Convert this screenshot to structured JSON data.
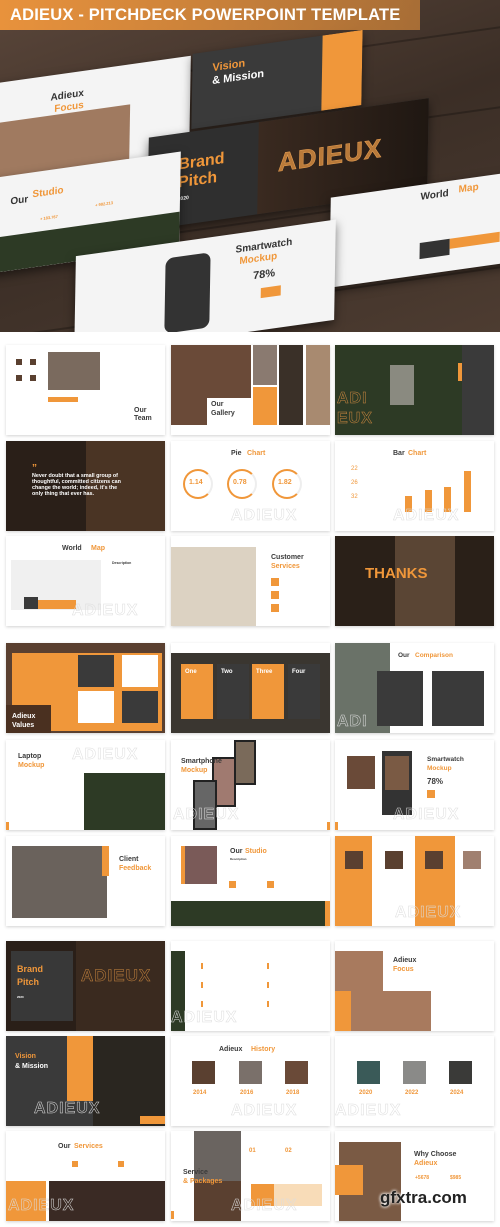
{
  "title": "ADIEUX - PITCHDECK POWERPOINT TEMPLATE",
  "colors": {
    "accent": "#f0973a",
    "dark": "#3a3a3a",
    "light": "#ffffff",
    "wood": "#4a3a30"
  },
  "hero": {
    "slides": [
      {
        "t1": "Adieux",
        "t2": "Focus"
      },
      {
        "t1": "Vision",
        "t2": "& Mission"
      },
      {
        "t1": "Brand",
        "t2": "Pitch",
        "sub": "2020"
      },
      {
        "t1": "Our",
        "t2": "Studio",
        "n1": "+ 183.767",
        "n2": "+ 982.213"
      },
      {
        "t1": "World",
        "t2": "Map"
      },
      {
        "t1": "Smartwatch",
        "t2": "Mockup",
        "pct": "78%"
      }
    ],
    "watermark": "ADIEUX"
  },
  "slides": [
    {
      "texts": [
        "Our",
        "Team"
      ]
    },
    {
      "texts": [
        "Our",
        "Gallery"
      ]
    },
    {
      "texts": [
        "ADI",
        "EUX"
      ]
    },
    {
      "texts": [
        "”",
        "Never doubt that a small group of thoughtful, committed citizens can change the world; indeed, it's the only thing that ever has."
      ]
    },
    {
      "texts": [
        "Pie",
        "Chart",
        "1.14",
        "0.78",
        "1.82",
        "ADIEUX"
      ]
    },
    {
      "texts": [
        "Bar",
        "Chart",
        "22",
        "26",
        "32",
        "ADIEUX"
      ]
    },
    {
      "texts": [
        "World",
        "Map",
        "Description",
        "ADIEUX"
      ]
    },
    {
      "texts": [
        "Customer",
        "Services"
      ]
    },
    {
      "texts": [
        "THANKS"
      ]
    },
    {
      "texts": [
        "Adieux",
        "Values"
      ]
    },
    {
      "texts": [
        "One",
        "Two",
        "Three",
        "Four"
      ]
    },
    {
      "texts": [
        "Our",
        "Comparison",
        "ADI"
      ]
    },
    {
      "texts": [
        "Laptop",
        "Mockup",
        "ADIEUX"
      ]
    },
    {
      "texts": [
        "Smartphone",
        "Mockup",
        "ADIEUX"
      ]
    },
    {
      "texts": [
        "Smartwatch",
        "Mockup",
        "78%",
        "ADIEUX"
      ]
    },
    {
      "texts": [
        "Client",
        "Feedback"
      ]
    },
    {
      "texts": [
        "Our",
        "Studio",
        "Description"
      ]
    },
    {
      "texts": [
        "ADIEUX"
      ]
    },
    {
      "texts": [
        "Brand",
        "Pitch",
        "2020",
        "ADIEUX"
      ]
    },
    {
      "texts": [
        "ADIEUX"
      ]
    },
    {
      "texts": [
        "Adieux",
        "Focus"
      ]
    },
    {
      "texts": [
        "Vision",
        "& Mission",
        "ADIEUX"
      ]
    },
    {
      "texts": [
        "Adieux",
        "History",
        "2014",
        "2016",
        "2018",
        "ADIEUX"
      ]
    },
    {
      "texts": [
        "2020",
        "2022",
        "2024",
        "ADIEUX"
      ]
    },
    {
      "texts": [
        "Our",
        "Services",
        "ADIEUX"
      ]
    },
    {
      "texts": [
        "Service",
        "& Packages",
        "01",
        "02",
        "ADIEUX"
      ]
    },
    {
      "texts": [
        "Why Choose",
        "Adieux",
        "+5678",
        "$985"
      ]
    }
  ],
  "watermark_site": "gfxtra.com"
}
